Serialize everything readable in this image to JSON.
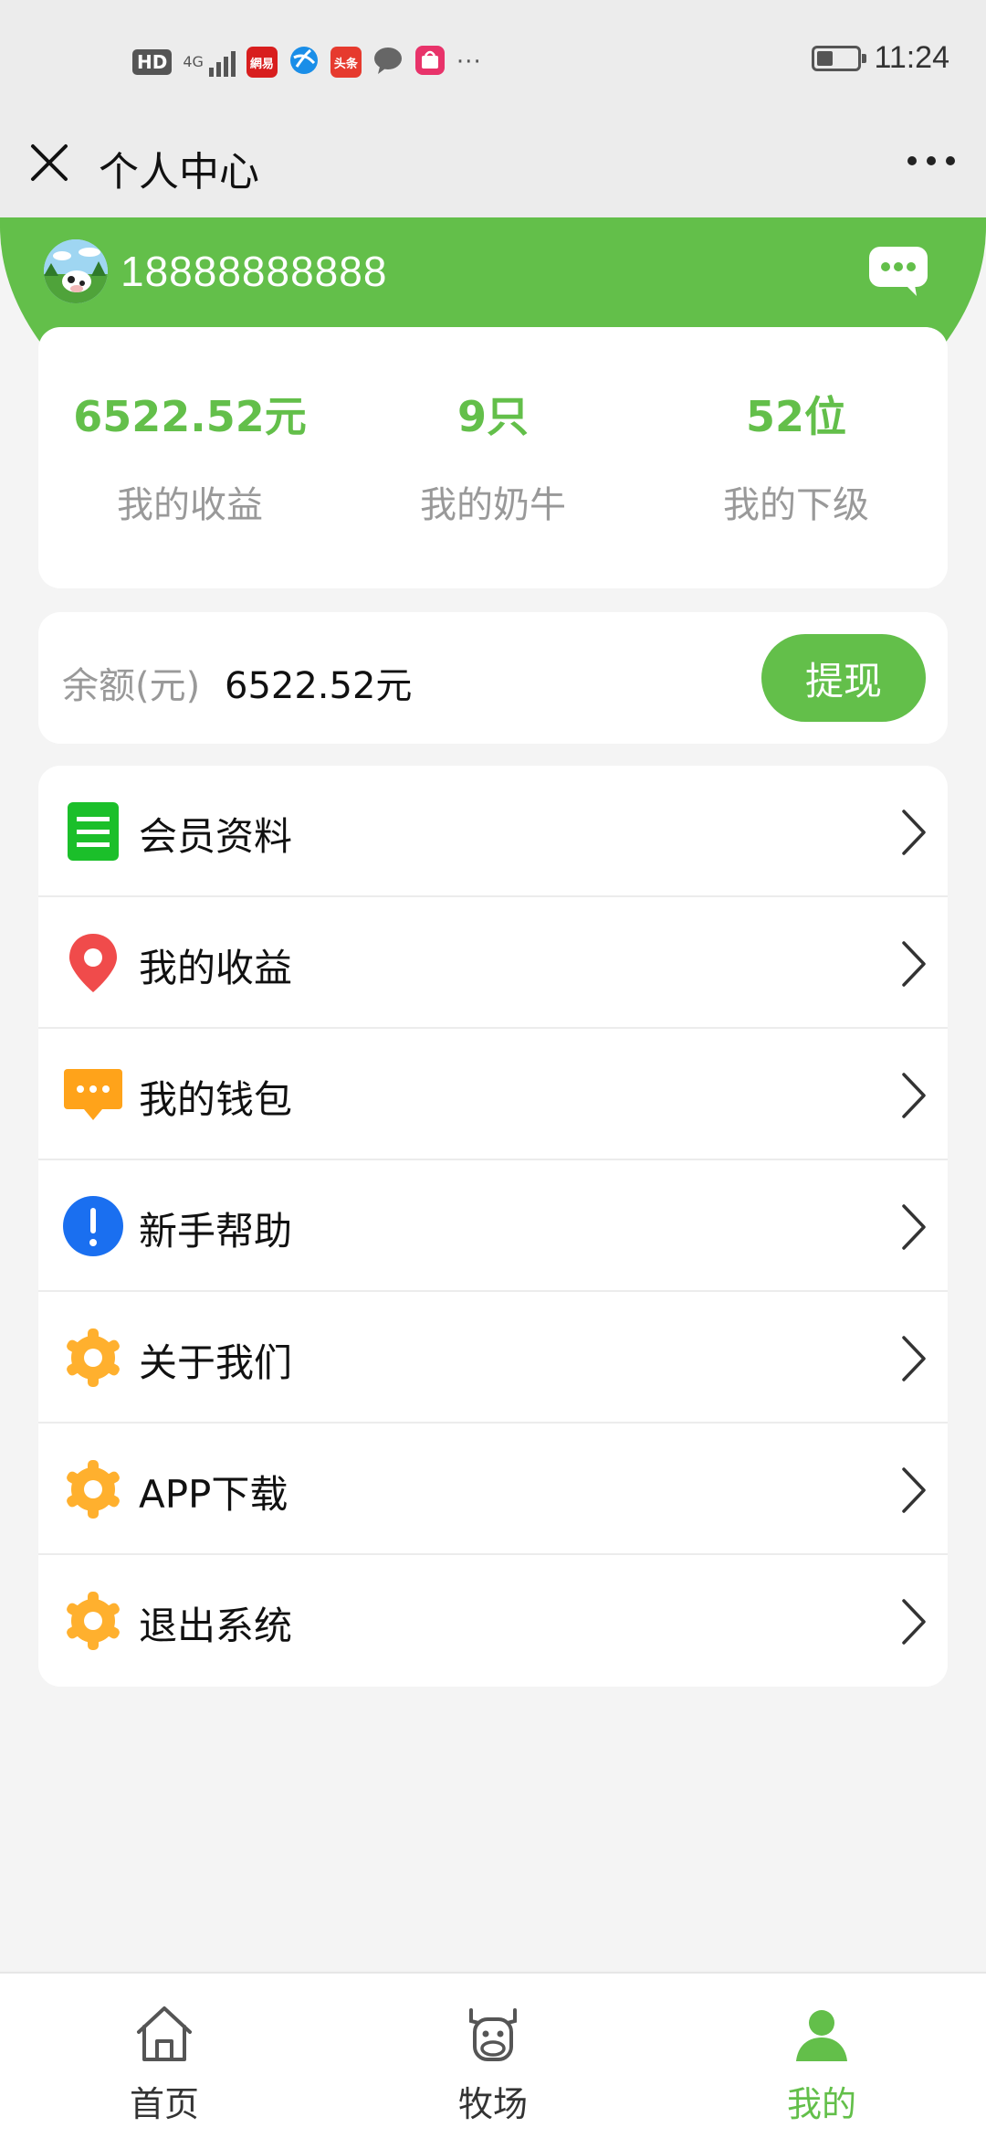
{
  "status_bar": {
    "hd": "HD",
    "network": "4G",
    "apps": [
      "網易",
      "头条"
    ],
    "more": "···",
    "battery_level": 0.4,
    "time": "11:24"
  },
  "title_bar": {
    "title": "个人中心"
  },
  "profile": {
    "phone": "18888888888"
  },
  "stats": [
    {
      "value": "6522.52元",
      "label": "我的收益"
    },
    {
      "value": "9只",
      "label": "我的奶牛"
    },
    {
      "value": "52位",
      "label": "我的下级"
    }
  ],
  "balance": {
    "label": "余额(元)",
    "value": "6522.52元",
    "withdraw_label": "提现"
  },
  "menu": [
    {
      "label": "会员资料",
      "icon": "member-info-icon"
    },
    {
      "label": "我的收益",
      "icon": "location-pin-icon"
    },
    {
      "label": "我的钱包",
      "icon": "chat-bubble-icon"
    },
    {
      "label": "新手帮助",
      "icon": "exclamation-icon"
    },
    {
      "label": "关于我们",
      "icon": "gear-icon"
    },
    {
      "label": "APP下载",
      "icon": "gear-icon"
    },
    {
      "label": "退出系统",
      "icon": "gear-icon"
    }
  ],
  "bottom_nav": [
    {
      "label": "首页",
      "icon": "home-icon",
      "active": false
    },
    {
      "label": "牧场",
      "icon": "cow-icon",
      "active": false
    },
    {
      "label": "我的",
      "icon": "user-icon",
      "active": true
    }
  ],
  "colors": {
    "accent": "#63bf4a",
    "menu_green": "#1bbf2a",
    "pin_red": "#f04b4b",
    "wallet_orange": "#ffa31a",
    "help_blue": "#1a6ff0",
    "gear_orange": "#ffb02e"
  }
}
